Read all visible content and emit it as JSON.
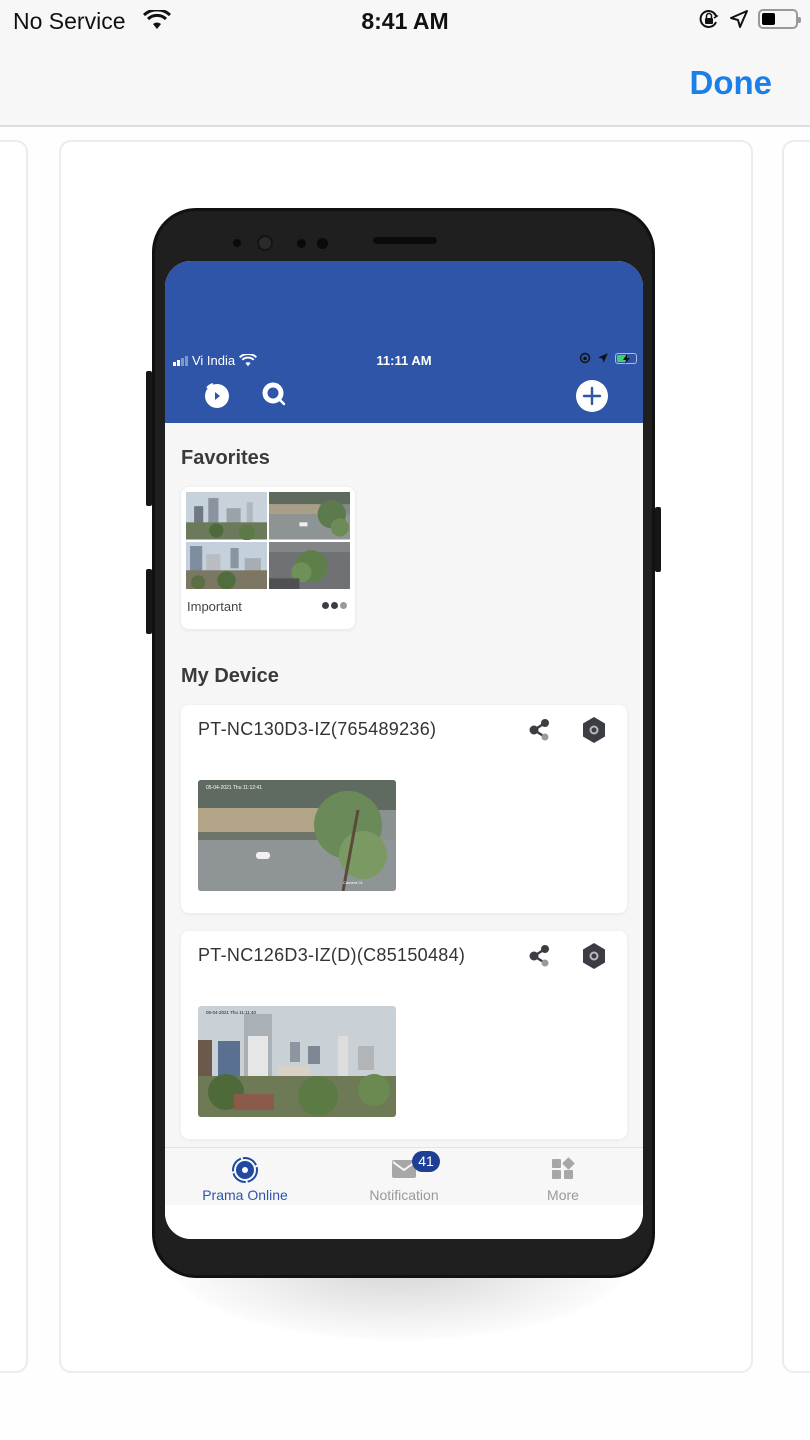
{
  "ios_status": {
    "carrier": "No Service",
    "time": "8:41 AM",
    "icons": [
      "wifi-icon",
      "orientation-lock-icon",
      "location-arrow-icon",
      "battery-icon"
    ],
    "battery_level": 0.4
  },
  "ios_nav": {
    "done_label": "Done"
  },
  "app": {
    "status": {
      "carrier": "Vi India",
      "time": "11:11 AM",
      "battery_charging": true
    },
    "header_icons": {
      "left": [
        "playback-icon",
        "search-icon"
      ],
      "right": "add-icon"
    },
    "accent_color": "#2e55a7",
    "favorites": {
      "title": "Favorites",
      "items": [
        {
          "label": "Important",
          "thumbnail_count": 4
        }
      ]
    },
    "my_device": {
      "title": "My Device",
      "devices": [
        {
          "name": "PT-NC130D3-IZ(765489236)"
        },
        {
          "name": "PT-NC126D3-IZ(D)(C85150484)"
        }
      ]
    },
    "bottom_nav": {
      "items": [
        {
          "label": "Prama Online",
          "icon": "live-view-icon",
          "active": true
        },
        {
          "label": "Notification",
          "icon": "mail-icon",
          "badge": "41",
          "active": false
        },
        {
          "label": "More",
          "icon": "grid-icon",
          "active": false
        }
      ]
    }
  }
}
